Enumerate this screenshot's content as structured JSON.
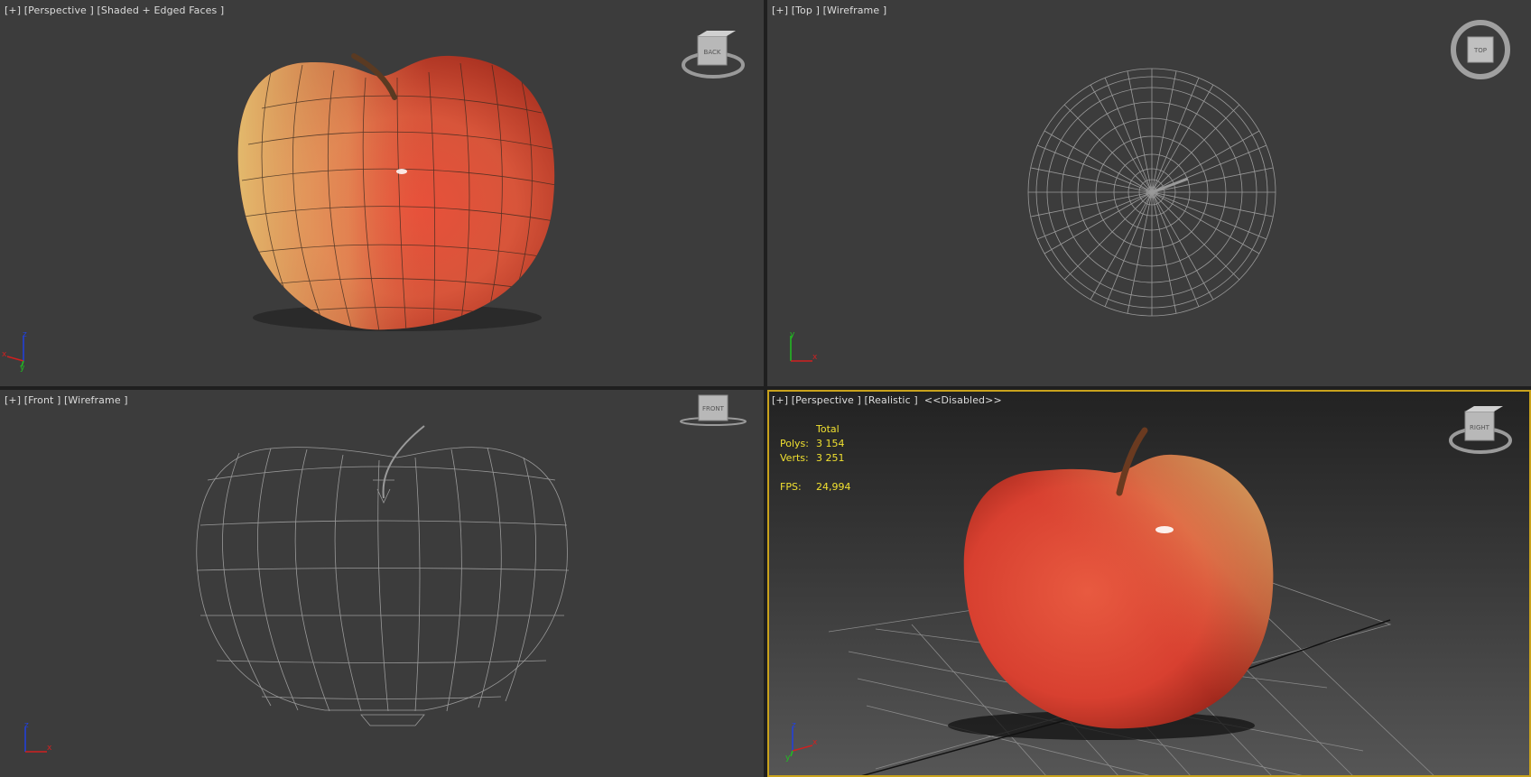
{
  "viewports": {
    "top_left": {
      "label_plus": "[+]",
      "label_view": "[Perspective ]",
      "label_mode": "[Shaded + Edged Faces ]",
      "cube_label": "BACK"
    },
    "top_right": {
      "label_plus": "[+]",
      "label_view": "[Top ]",
      "label_mode": "[Wireframe ]",
      "cube_label": "TOP"
    },
    "bottom_left": {
      "label_plus": "[+]",
      "label_view": "[Front ]",
      "label_mode": "[Wireframe ]",
      "cube_label": "FRONT"
    },
    "bottom_right": {
      "label_plus": "[+]",
      "label_view": "[Perspective ]",
      "label_mode": "[Realistic ]",
      "label_extra": "<<Disabled>>",
      "cube_label": "RIGHT"
    }
  },
  "stats": {
    "header": "Total",
    "polys_label": "Polys:",
    "polys_value": "3 154",
    "verts_label": "Verts:",
    "verts_value": "3 251",
    "fps_label": "FPS:",
    "fps_value": "24,994"
  },
  "axis_labels": {
    "top_left": {
      "a": "x",
      "b": "y",
      "c": "z"
    },
    "top_right": {
      "a": "x",
      "b": "y"
    },
    "bottom_left": {
      "a": "x",
      "b": "z"
    },
    "bottom_right": {
      "a": "x",
      "b": "y",
      "c": "z"
    }
  },
  "colors": {
    "viewport_bg": "#3c3c3c",
    "active_border": "#c9a21c",
    "stats_text": "#f0e030",
    "wire": "#9a9a9a",
    "axis_x": "#d02020",
    "axis_y": "#20c020",
    "axis_z": "#2040e0"
  }
}
